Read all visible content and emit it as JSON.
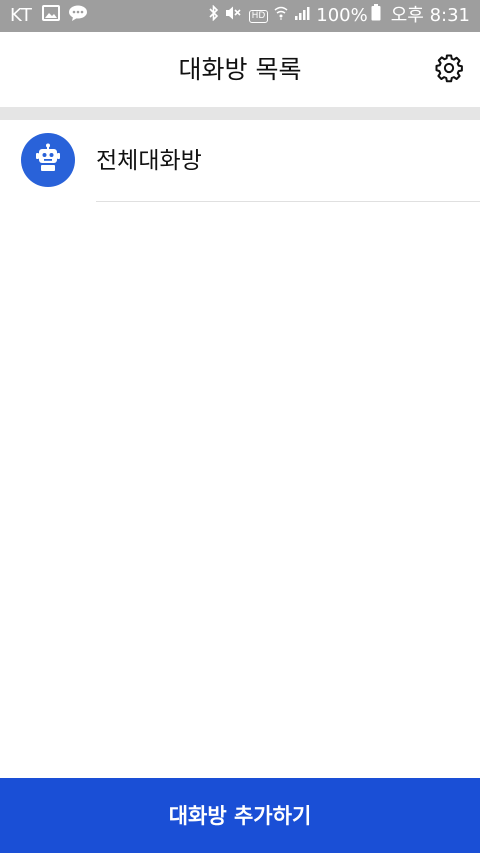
{
  "status_bar": {
    "carrier": "KT",
    "hd_label": "HD",
    "battery": "100%",
    "time": "오후 8:31"
  },
  "header": {
    "title": "대화방 목록",
    "settings_icon": "gear-icon"
  },
  "rooms": [
    {
      "name": "전체대화방",
      "avatar_icon": "robot-icon"
    }
  ],
  "footer": {
    "add_button_label": "대화방 추가하기"
  },
  "colors": {
    "status_bar_bg": "#9e9e9e",
    "accent_blue": "#2962d9",
    "button_blue": "#1a4fd6",
    "divider": "#e5e5e5"
  }
}
